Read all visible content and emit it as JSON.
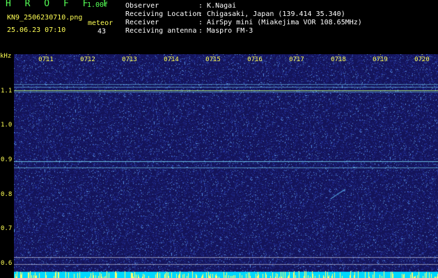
{
  "app": {
    "name": "H R O F F T",
    "version": "1.00f",
    "filename": "KN9_2506230710.png",
    "datetime": "25.06.23 07:10",
    "meteors_label": "meteor",
    "meteors_count": "43"
  },
  "info": [
    {
      "key": "Observer",
      "value": ": K.Nagai"
    },
    {
      "key": "Receiving Location",
      "value": ": Chigasaki, Japan (139.414 35.340)"
    },
    {
      "key": "Receiver",
      "value": ": AirSpy mini (Miakejima VOR 108.65MHz)"
    },
    {
      "key": "Receiving antenna",
      "value": ": Maspro FM-3"
    }
  ],
  "y_axis": {
    "unit": "kHz",
    "ticks": [
      "1.1",
      "1.0",
      "0.9",
      "0.8",
      "0.7",
      "0.6"
    ]
  },
  "time_axis": {
    "ticks": [
      "0711",
      "0712",
      "0713",
      "0714",
      "0715",
      "0716",
      "0717",
      "0718",
      "0719",
      "0720"
    ]
  },
  "colors": {
    "background": "#000000",
    "spectrogram": "#14145a",
    "label": "#ffff55",
    "title": "#55ff55",
    "signal": "#80e8ff"
  }
}
